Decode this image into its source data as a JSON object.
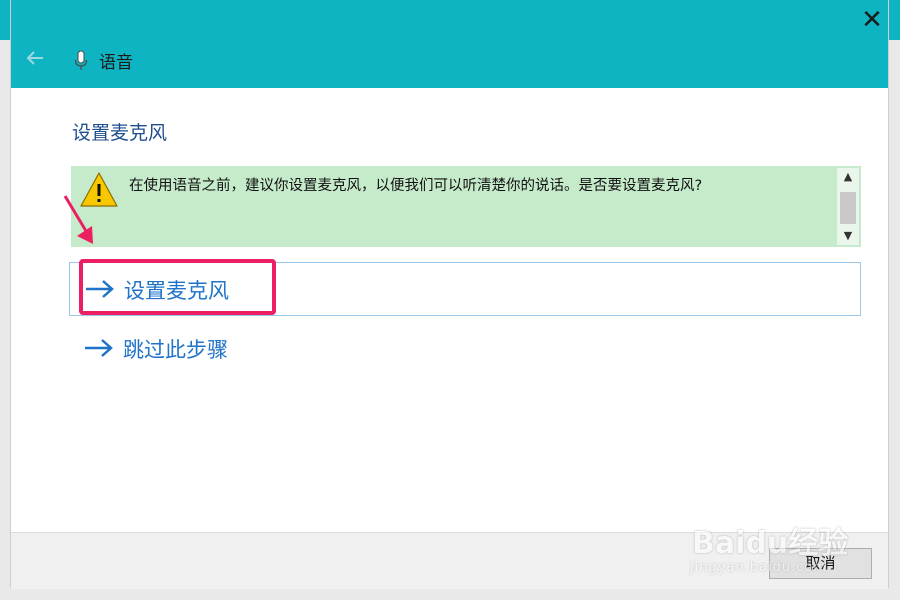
{
  "header": {
    "title": "语音",
    "close_glyph": "✕"
  },
  "page_title": "设置麦克风",
  "notice": {
    "text": "在使用语音之前，建议你设置麦克风，以便我们可以听清楚你的说话。是否要设置麦克风?",
    "scroll_up": "▲",
    "scroll_down": "▼"
  },
  "options": [
    {
      "label": "设置麦克风",
      "icon": "right-arrow-icon"
    },
    {
      "label": "跳过此步骤",
      "icon": "right-arrow-icon"
    }
  ],
  "footer": {
    "cancel_label": "取消"
  },
  "watermark": {
    "brand": "Baidu经验",
    "sub": "jingyan.baidu.com"
  },
  "colors": {
    "header_bg": "#0eb4c2",
    "notice_bg": "#c6ebcb",
    "link": "#1f73c8",
    "highlight": "#ec1f62"
  }
}
